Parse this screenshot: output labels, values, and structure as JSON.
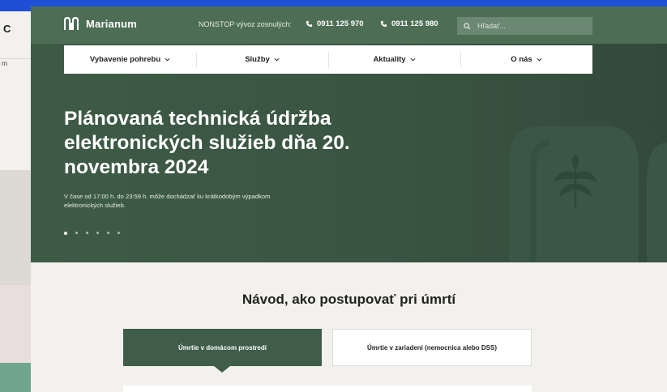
{
  "background_window": {
    "letter": "C",
    "text": "rn"
  },
  "header": {
    "logo_text": "Marianum",
    "nonstop_label": "NONSTOP vývoz zosnulých:",
    "phones": [
      "0911 125 970",
      "0911 125 980"
    ],
    "search_placeholder": "Hľadať..."
  },
  "nav": {
    "items": [
      {
        "label": "Vybavenie pohrebu"
      },
      {
        "label": "Služby"
      },
      {
        "label": "Aktuality"
      },
      {
        "label": "O nás"
      }
    ]
  },
  "hero": {
    "title": "Plánovaná technická údržba elektronických služieb dňa 20. novembra 2024",
    "description": "V čase od 17:00 h. do 23:59 h. môže dochádzať ku krátkodobým výpadkom elektronických služieb.",
    "slides_total": 6,
    "slide_active": 1
  },
  "guide": {
    "title": "Návod, ako postupovať pri úmrtí",
    "tabs": [
      {
        "label": "Úmrtie v domácom prostredí",
        "active": true
      },
      {
        "label": "Úmrtie v zariadení (nemocnica alebo DSS)",
        "active": false
      }
    ]
  },
  "colors": {
    "brand_green": "#3f5d48",
    "topbar_green": "#4d6e55",
    "desktop_blue": "#1f4fd6"
  },
  "icons": [
    "logo-mark-icon",
    "phone-icon",
    "search-icon",
    "chevron-down-icon"
  ]
}
